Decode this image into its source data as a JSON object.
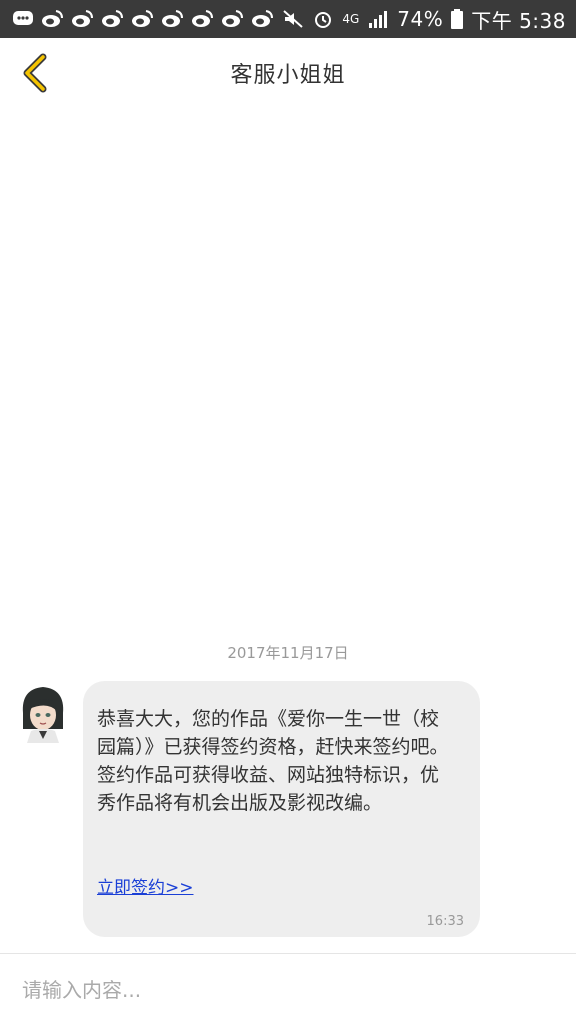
{
  "status_bar": {
    "network": "4G",
    "battery_percent": "74%",
    "time": "下午 5:38"
  },
  "header": {
    "title": "客服小姐姐"
  },
  "chat": {
    "date": "2017年11月17日",
    "message": {
      "text": "恭喜大大，您的作品《爱你一生一世（校园篇）》已获得签约资格，赶快来签约吧。签约作品可获得收益、网站独特标识，优秀作品将有机会出版及影视改编。",
      "link_label": "立即签约>>",
      "time": "16:33"
    }
  },
  "input": {
    "placeholder": "请输入内容..."
  },
  "colors": {
    "accent_yellow": "#f5c400",
    "link_blue": "#1a3fd6",
    "bubble_bg": "#eeeeee"
  }
}
